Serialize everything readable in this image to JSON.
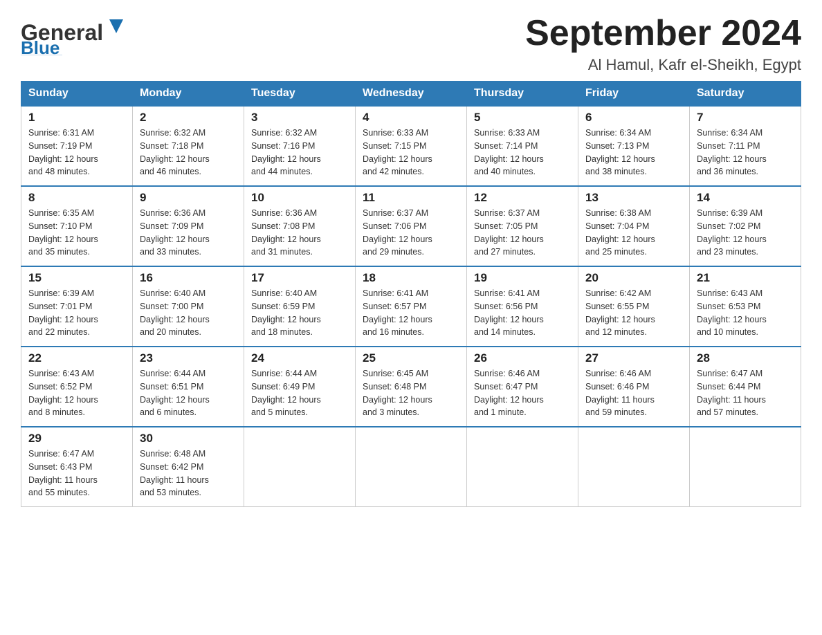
{
  "header": {
    "logo_general": "General",
    "logo_blue": "Blue",
    "month_title": "September 2024",
    "location": "Al Hamul, Kafr el-Sheikh, Egypt"
  },
  "weekdays": [
    "Sunday",
    "Monday",
    "Tuesday",
    "Wednesday",
    "Thursday",
    "Friday",
    "Saturday"
  ],
  "weeks": [
    [
      {
        "day": "1",
        "sunrise": "6:31 AM",
        "sunset": "7:19 PM",
        "daylight": "12 hours and 48 minutes."
      },
      {
        "day": "2",
        "sunrise": "6:32 AM",
        "sunset": "7:18 PM",
        "daylight": "12 hours and 46 minutes."
      },
      {
        "day": "3",
        "sunrise": "6:32 AM",
        "sunset": "7:16 PM",
        "daylight": "12 hours and 44 minutes."
      },
      {
        "day": "4",
        "sunrise": "6:33 AM",
        "sunset": "7:15 PM",
        "daylight": "12 hours and 42 minutes."
      },
      {
        "day": "5",
        "sunrise": "6:33 AM",
        "sunset": "7:14 PM",
        "daylight": "12 hours and 40 minutes."
      },
      {
        "day": "6",
        "sunrise": "6:34 AM",
        "sunset": "7:13 PM",
        "daylight": "12 hours and 38 minutes."
      },
      {
        "day": "7",
        "sunrise": "6:34 AM",
        "sunset": "7:11 PM",
        "daylight": "12 hours and 36 minutes."
      }
    ],
    [
      {
        "day": "8",
        "sunrise": "6:35 AM",
        "sunset": "7:10 PM",
        "daylight": "12 hours and 35 minutes."
      },
      {
        "day": "9",
        "sunrise": "6:36 AM",
        "sunset": "7:09 PM",
        "daylight": "12 hours and 33 minutes."
      },
      {
        "day": "10",
        "sunrise": "6:36 AM",
        "sunset": "7:08 PM",
        "daylight": "12 hours and 31 minutes."
      },
      {
        "day": "11",
        "sunrise": "6:37 AM",
        "sunset": "7:06 PM",
        "daylight": "12 hours and 29 minutes."
      },
      {
        "day": "12",
        "sunrise": "6:37 AM",
        "sunset": "7:05 PM",
        "daylight": "12 hours and 27 minutes."
      },
      {
        "day": "13",
        "sunrise": "6:38 AM",
        "sunset": "7:04 PM",
        "daylight": "12 hours and 25 minutes."
      },
      {
        "day": "14",
        "sunrise": "6:39 AM",
        "sunset": "7:02 PM",
        "daylight": "12 hours and 23 minutes."
      }
    ],
    [
      {
        "day": "15",
        "sunrise": "6:39 AM",
        "sunset": "7:01 PM",
        "daylight": "12 hours and 22 minutes."
      },
      {
        "day": "16",
        "sunrise": "6:40 AM",
        "sunset": "7:00 PM",
        "daylight": "12 hours and 20 minutes."
      },
      {
        "day": "17",
        "sunrise": "6:40 AM",
        "sunset": "6:59 PM",
        "daylight": "12 hours and 18 minutes."
      },
      {
        "day": "18",
        "sunrise": "6:41 AM",
        "sunset": "6:57 PM",
        "daylight": "12 hours and 16 minutes."
      },
      {
        "day": "19",
        "sunrise": "6:41 AM",
        "sunset": "6:56 PM",
        "daylight": "12 hours and 14 minutes."
      },
      {
        "day": "20",
        "sunrise": "6:42 AM",
        "sunset": "6:55 PM",
        "daylight": "12 hours and 12 minutes."
      },
      {
        "day": "21",
        "sunrise": "6:43 AM",
        "sunset": "6:53 PM",
        "daylight": "12 hours and 10 minutes."
      }
    ],
    [
      {
        "day": "22",
        "sunrise": "6:43 AM",
        "sunset": "6:52 PM",
        "daylight": "12 hours and 8 minutes."
      },
      {
        "day": "23",
        "sunrise": "6:44 AM",
        "sunset": "6:51 PM",
        "daylight": "12 hours and 6 minutes."
      },
      {
        "day": "24",
        "sunrise": "6:44 AM",
        "sunset": "6:49 PM",
        "daylight": "12 hours and 5 minutes."
      },
      {
        "day": "25",
        "sunrise": "6:45 AM",
        "sunset": "6:48 PM",
        "daylight": "12 hours and 3 minutes."
      },
      {
        "day": "26",
        "sunrise": "6:46 AM",
        "sunset": "6:47 PM",
        "daylight": "12 hours and 1 minute."
      },
      {
        "day": "27",
        "sunrise": "6:46 AM",
        "sunset": "6:46 PM",
        "daylight": "11 hours and 59 minutes."
      },
      {
        "day": "28",
        "sunrise": "6:47 AM",
        "sunset": "6:44 PM",
        "daylight": "11 hours and 57 minutes."
      }
    ],
    [
      {
        "day": "29",
        "sunrise": "6:47 AM",
        "sunset": "6:43 PM",
        "daylight": "11 hours and 55 minutes."
      },
      {
        "day": "30",
        "sunrise": "6:48 AM",
        "sunset": "6:42 PM",
        "daylight": "11 hours and 53 minutes."
      },
      null,
      null,
      null,
      null,
      null
    ]
  ],
  "labels": {
    "sunrise": "Sunrise:",
    "sunset": "Sunset:",
    "daylight": "Daylight:"
  }
}
